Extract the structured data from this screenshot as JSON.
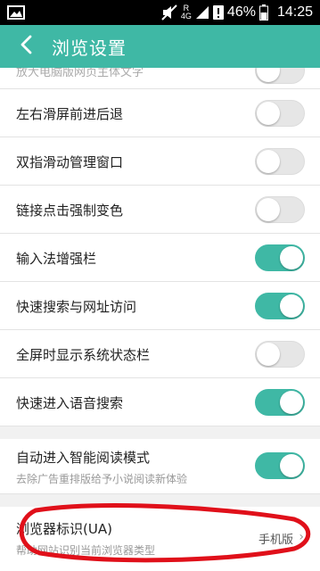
{
  "status_bar": {
    "battery_percent": "46%",
    "time": "14:25",
    "network_label": "4G"
  },
  "header": {
    "title": "浏览设置"
  },
  "settings": [
    {
      "label": "放大电脑版网页主体文字",
      "enabled": false
    },
    {
      "label": "左右滑屏前进后退",
      "enabled": false
    },
    {
      "label": "双指滑动管理窗口",
      "enabled": false
    },
    {
      "label": "链接点击强制变色",
      "enabled": false
    },
    {
      "label": "输入法增强栏",
      "enabled": true
    },
    {
      "label": "快速搜索与网址访问",
      "enabled": true
    },
    {
      "label": "全屏时显示系统状态栏",
      "enabled": false
    },
    {
      "label": "快速进入语音搜索",
      "enabled": true
    }
  ],
  "smart_reading": {
    "label": "自动进入智能阅读模式",
    "description": "去除广告重排版给予小说阅读新体验",
    "enabled": true
  },
  "ua": {
    "label": "浏览器标识(UA)",
    "description": "帮助网站识别当前浏览器类型",
    "value": "手机版"
  },
  "colors": {
    "accent": "#3fb8a5",
    "annotation": "#e0101a"
  }
}
